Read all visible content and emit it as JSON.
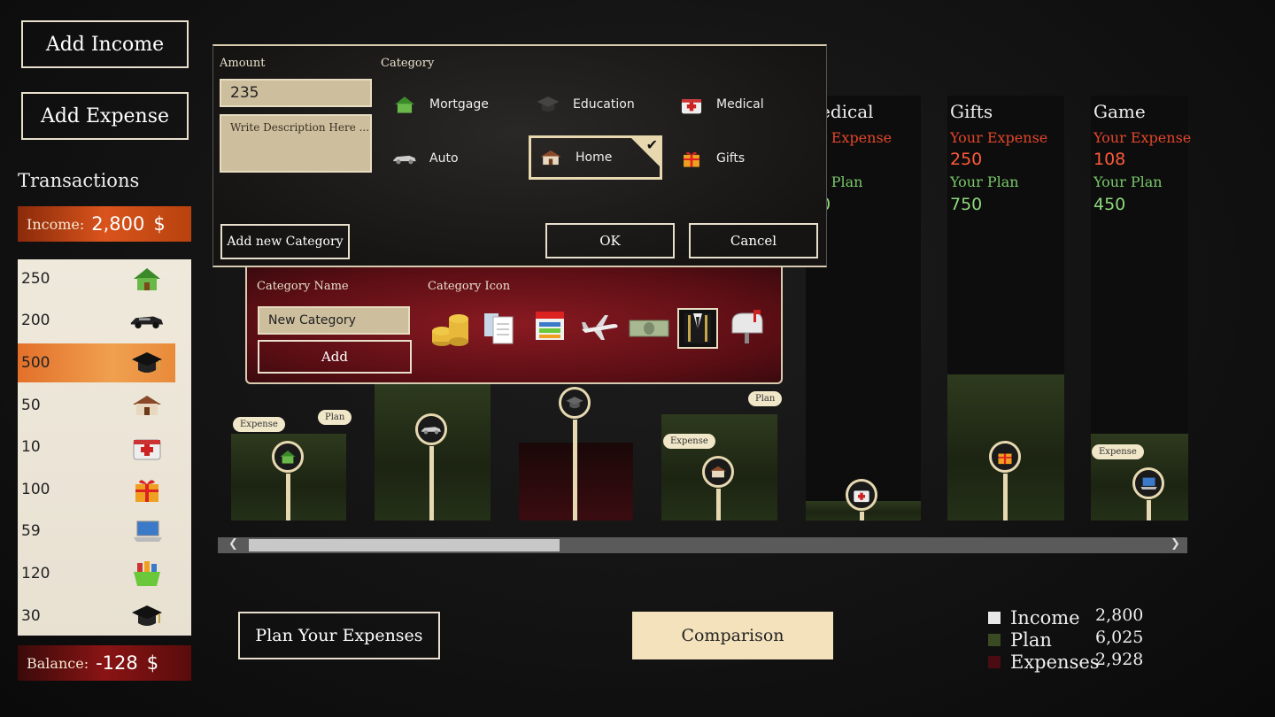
{
  "colors": {
    "accent": "#e8e0cc",
    "expense": "#ff5a3a",
    "plan": "#8ed87a",
    "income_bar": "#d9541c",
    "balance_bar": "#8a1414"
  },
  "left": {
    "add_income": "Add Income",
    "add_expense": "Add Expense",
    "transactions_title": "Transactions",
    "income_label": "Income:",
    "income_value": "2,800",
    "income_unit": "$",
    "balance_label": "Balance:",
    "balance_value": "-128",
    "balance_unit": "$",
    "transactions": [
      {
        "amount": "250",
        "icon": "house-green-icon"
      },
      {
        "amount": "200",
        "icon": "car-icon"
      },
      {
        "amount": "500",
        "icon": "graduation-cap-icon"
      },
      {
        "amount": "50",
        "icon": "house-icon"
      },
      {
        "amount": "10",
        "icon": "medical-kit-icon"
      },
      {
        "amount": "100",
        "icon": "gift-icon"
      },
      {
        "amount": "59",
        "icon": "laptop-icon"
      },
      {
        "amount": "120",
        "icon": "basket-icon"
      },
      {
        "amount": "30",
        "icon": "graduation-cap-icon"
      }
    ]
  },
  "categories_top": [
    {
      "name": "edical",
      "exp_label": "r Expense",
      "plan_label": "r Plan",
      "plan_value": "0"
    },
    {
      "name": "Gifts",
      "exp_label": "Your Expense",
      "exp_value": "250",
      "plan_label": "Your Plan",
      "plan_value": "750"
    },
    {
      "name": "Game",
      "exp_label": "Your Expense",
      "exp_value": "108",
      "plan_label": "Your Plan",
      "plan_value": "450"
    }
  ],
  "bubbles": {
    "expense": "Expense",
    "plan": "Plan"
  },
  "dialog": {
    "amount_label": "Amount",
    "amount_value": "235",
    "description_placeholder": "Write Description Here ...",
    "category_label": "Category",
    "categories": [
      {
        "label": "Mortgage",
        "icon": "house-green-icon"
      },
      {
        "label": "Education",
        "icon": "graduation-cap-icon"
      },
      {
        "label": "Medical",
        "icon": "medical-kit-icon"
      },
      {
        "label": "Auto",
        "icon": "car-icon"
      },
      {
        "label": "Home",
        "icon": "house-icon",
        "selected": true
      },
      {
        "label": "Gifts",
        "icon": "gift-icon"
      }
    ],
    "add_new_category": "Add new Category",
    "ok": "OK",
    "cancel": "Cancel"
  },
  "new_category": {
    "name_label": "Category Name",
    "name_value": "New Category",
    "icon_label": "Category Icon",
    "add": "Add",
    "icons": [
      "coins-icon",
      "documents-icon",
      "calendar-icon",
      "airplane-icon",
      "dollar-bill-icon",
      "suit-icon",
      "mailbox-icon"
    ]
  },
  "bottom": {
    "plan_your_expenses": "Plan Your Expenses",
    "comparison": "Comparison"
  },
  "legend": [
    {
      "label": "Income",
      "value": "2,800",
      "color": "#e8e8e8"
    },
    {
      "label": "Plan",
      "value": "6,025",
      "color": "#3a4a22"
    },
    {
      "label": "Expenses",
      "value": "2,928",
      "color": "#4a0c12"
    }
  ]
}
